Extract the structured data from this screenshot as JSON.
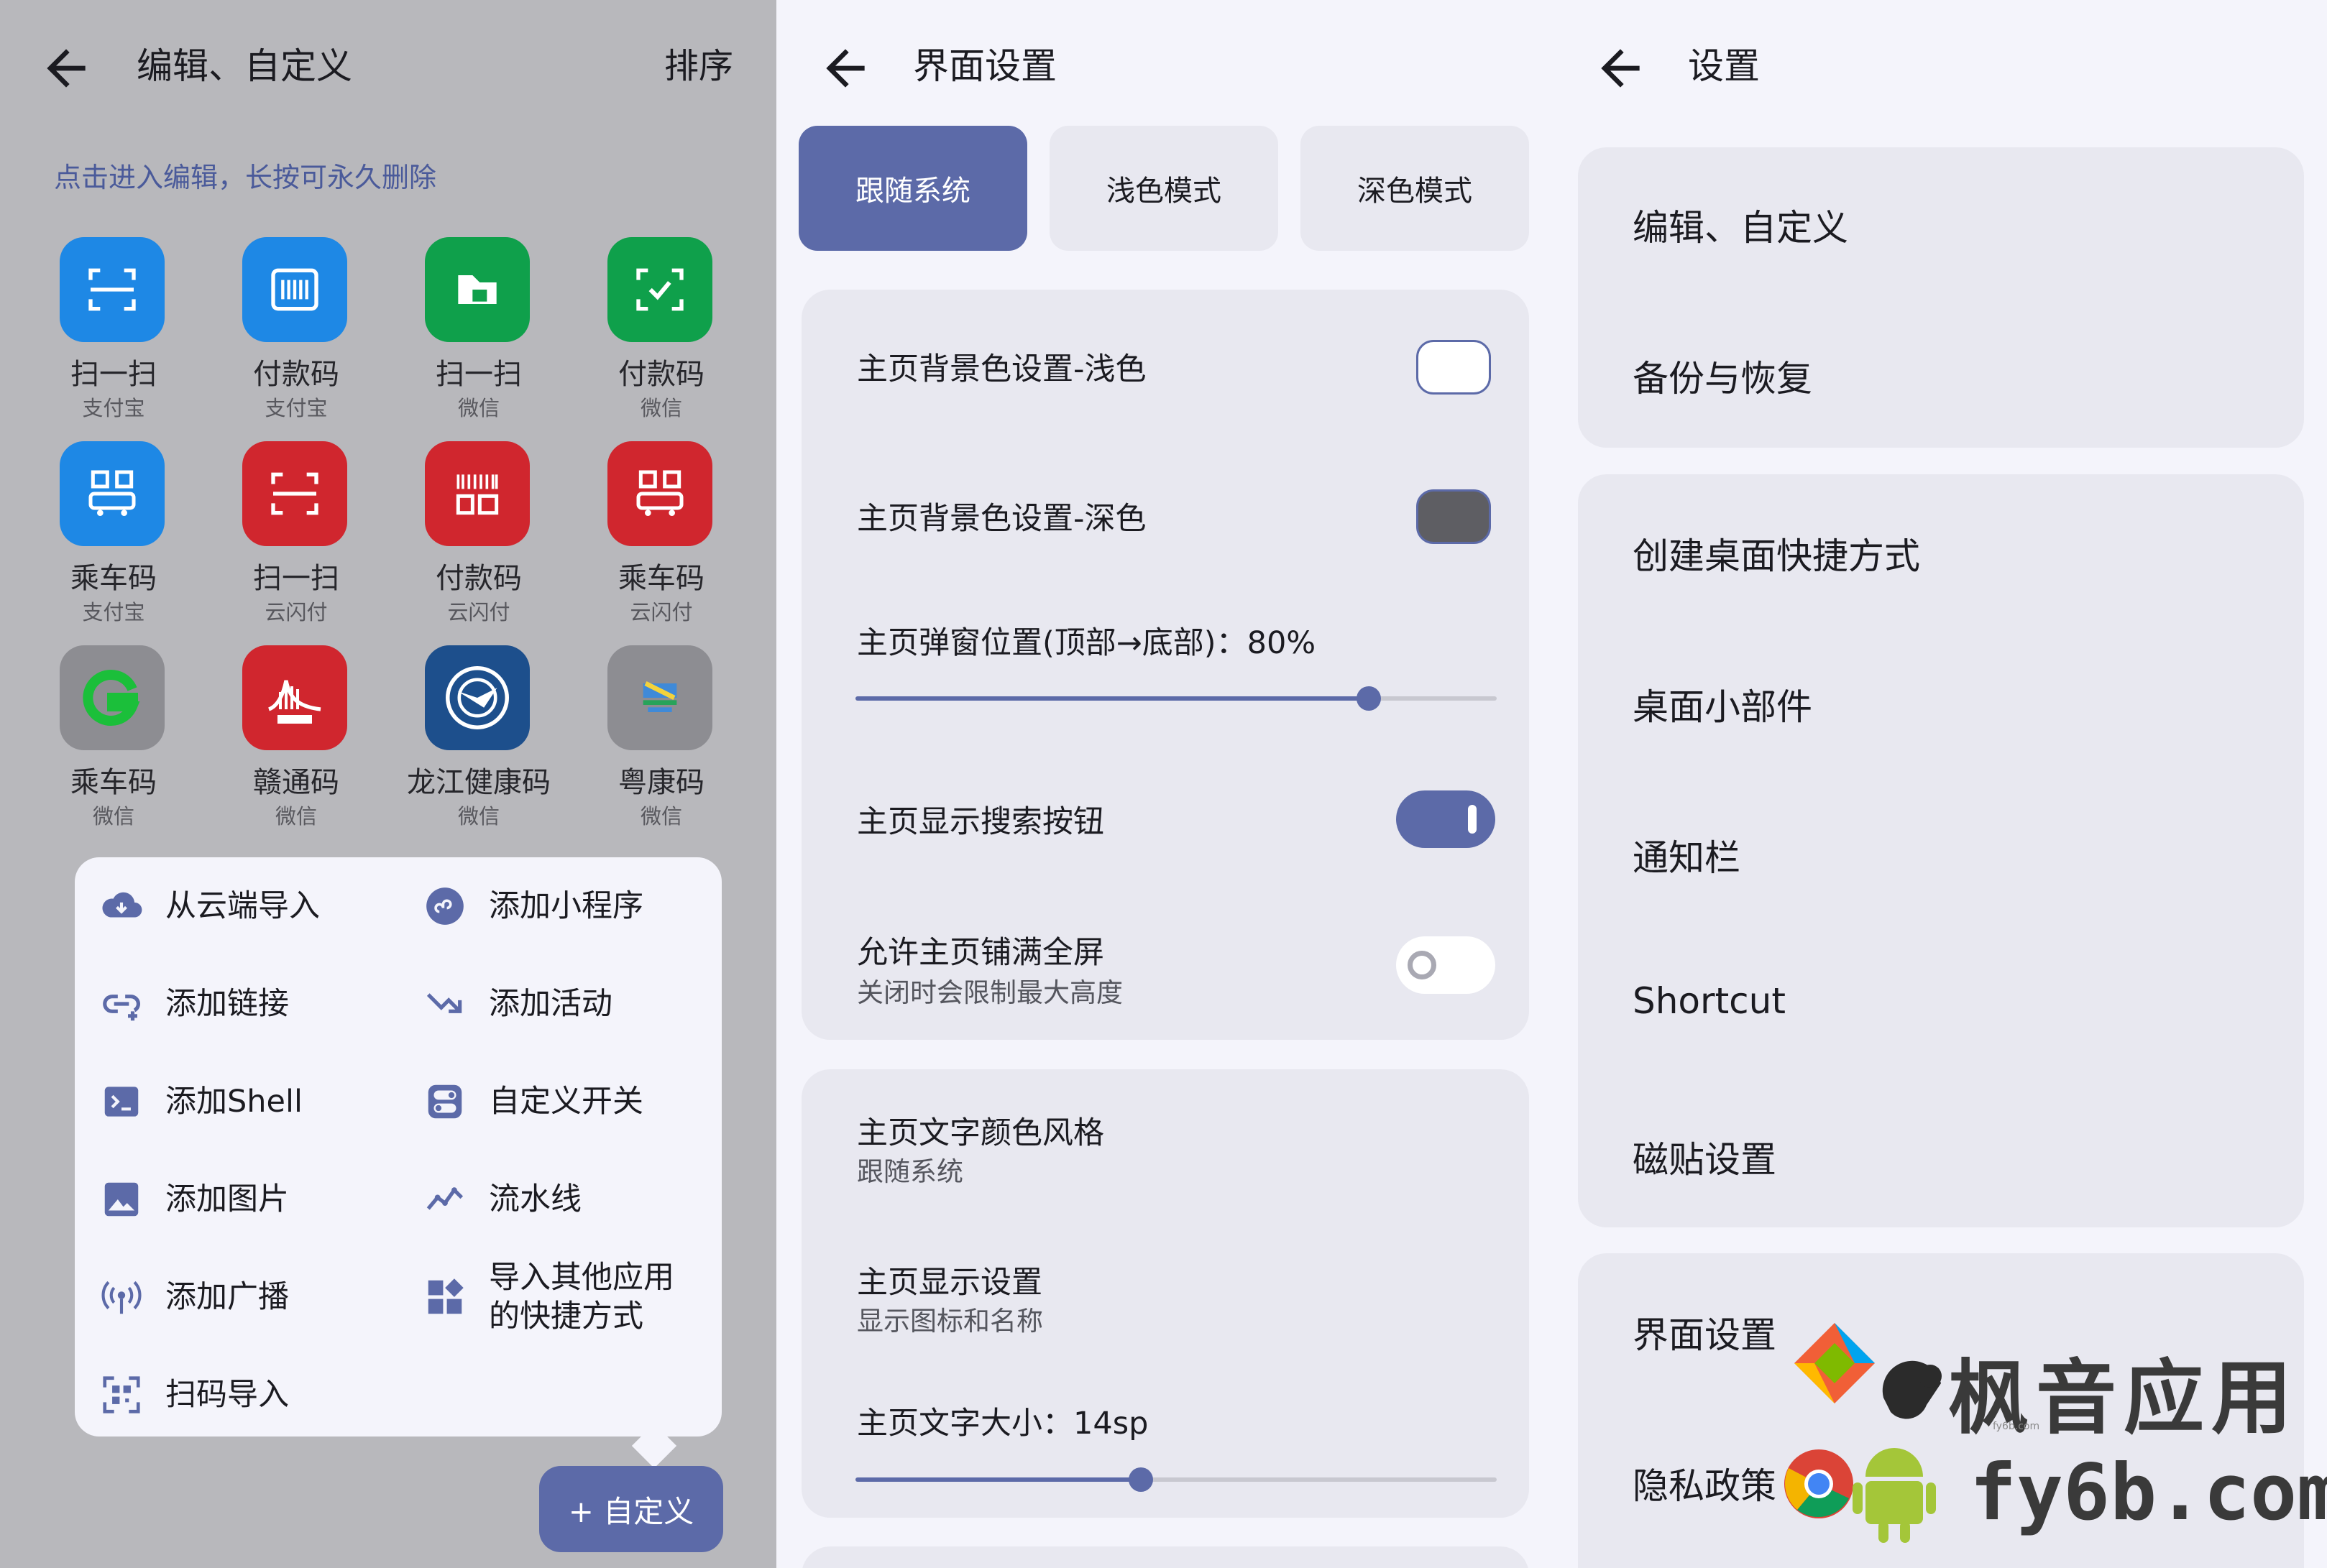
{
  "panel1": {
    "title": "编辑、自定义",
    "sort_label": "排序",
    "hint": "点击进入编辑，长按可永久删除",
    "apps": [
      {
        "name": "扫一扫",
        "source": "支付宝",
        "color": "#1e88e5",
        "icon": "scan-icon"
      },
      {
        "name": "付款码",
        "source": "支付宝",
        "color": "#1e88e5",
        "icon": "barcode-icon"
      },
      {
        "name": "扫一扫",
        "source": "微信",
        "color": "#0fa04b",
        "icon": "scan-icon"
      },
      {
        "name": "付款码",
        "source": "微信",
        "color": "#0fa04b",
        "icon": "pay-check-icon"
      },
      {
        "name": "乘车码",
        "source": "支付宝",
        "color": "#1e88e5",
        "icon": "bus-qr-icon"
      },
      {
        "name": "扫一扫",
        "source": "云闪付",
        "color": "#d0262e",
        "icon": "scan-icon"
      },
      {
        "name": "付款码",
        "source": "云闪付",
        "color": "#d0262e",
        "icon": "barcode-qr-icon"
      },
      {
        "name": "乘车码",
        "source": "云闪付",
        "color": "#d0262e",
        "icon": "bus-qr-icon"
      },
      {
        "name": "乘车码",
        "source": "微信",
        "color": "#8d8d92",
        "icon": "green-g-logo-icon"
      },
      {
        "name": "赣通码",
        "source": "微信",
        "color": "#d0262e",
        "icon": "gantong-logo-icon"
      },
      {
        "name": "龙江健康码",
        "source": "微信",
        "color": "#1d4f8c",
        "icon": "longjiang-logo-icon"
      },
      {
        "name": "粤康码",
        "source": "微信",
        "color": "#8d8d92",
        "icon": "yuekang-logo-icon"
      }
    ],
    "menu": [
      {
        "label": "从云端导入",
        "icon": "cloud-download-icon"
      },
      {
        "label": "添加小程序",
        "icon": "mini-program-icon"
      },
      {
        "label": "添加链接",
        "icon": "link-icon"
      },
      {
        "label": "添加活动",
        "icon": "activity-arrow-icon"
      },
      {
        "label": "添加Shell",
        "icon": "terminal-icon"
      },
      {
        "label": "自定义开关",
        "icon": "toggle-switch-icon"
      },
      {
        "label": "添加图片",
        "icon": "image-icon"
      },
      {
        "label": "流水线",
        "icon": "pipeline-icon"
      },
      {
        "label": "添加广播",
        "icon": "broadcast-icon"
      },
      {
        "label": "导入其他应用\n的快捷方式",
        "icon": "widgets-icon"
      },
      {
        "label": "扫码导入",
        "icon": "qr-scan-icon"
      }
    ],
    "fab_label": "+ 自定义"
  },
  "panel2": {
    "title": "界面设置",
    "segments": [
      "跟随系统",
      "浅色模式",
      "深色模式"
    ],
    "selected_segment": "跟随系统",
    "light_bg_label": "主页背景色设置-浅色",
    "light_bg_color": "#ffffff",
    "dark_bg_label": "主页背景色设置-深色",
    "dark_bg_color": "#5e5e63",
    "popup_position_label": "主页弹窗位置(顶部→底部)：80%",
    "popup_position_value": 0.8,
    "show_search_label": "主页显示搜索按钮",
    "show_search_on": true,
    "fullscreen_label": "允许主页铺满全屏",
    "fullscreen_sub": "关闭时会限制最大高度",
    "fullscreen_on": false,
    "text_color_style_label": "主页文字颜色风格",
    "text_color_style_value": "跟随系统",
    "display_label": "主页显示设置",
    "display_value": "显示图标和名称",
    "text_size_label": "主页文字大小：14sp",
    "text_size_value": 0.445
  },
  "panel3": {
    "title": "设置",
    "group1": [
      "编辑、自定义",
      "备份与恢复"
    ],
    "group2": [
      "创建桌面快捷方式",
      "桌面小部件",
      "通知栏",
      "Shortcut",
      "磁贴设置"
    ],
    "group3": [
      "界面设置",
      "隐私政策"
    ]
  },
  "watermark": {
    "line1": "枫音应用",
    "line2": "fy6b.com",
    "small": "fy6b.com"
  },
  "colors": {
    "accent": "#5c6aa8",
    "card": "#e8e8f0",
    "background": "#f4f4fb",
    "dim_overlay": "#b8b8bc"
  }
}
